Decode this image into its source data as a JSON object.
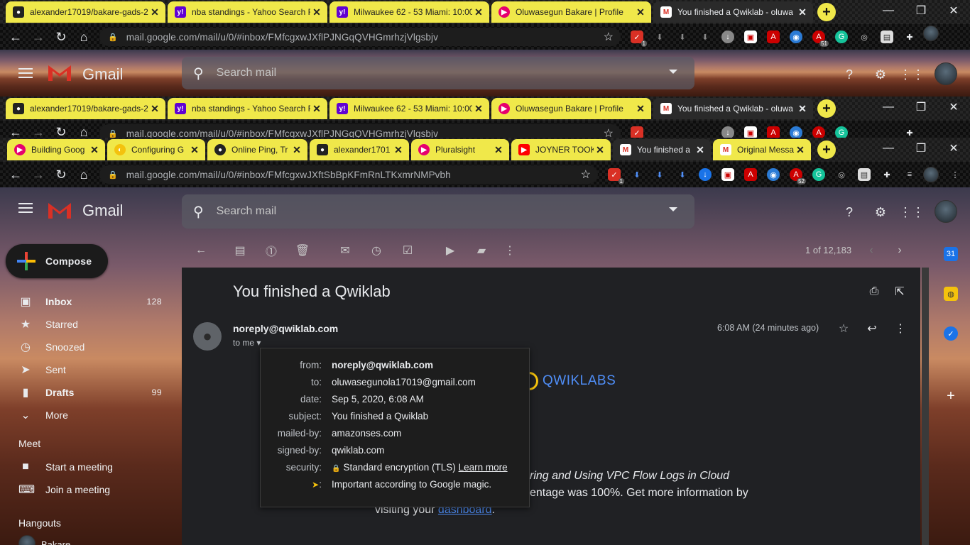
{
  "browser_top": {
    "tabs": [
      {
        "title": "alexander17019/bakare-gads-2",
        "favicon": "github-icon",
        "color": "#222"
      },
      {
        "title": "nba standings - Yahoo Search R",
        "favicon": "yahoo-icon",
        "color": "#6001d2"
      },
      {
        "title": "Milwaukee 62 - 53 Miami: 10:00",
        "favicon": "yahoo-icon",
        "color": "#6001d2"
      },
      {
        "title": "Oluwasegun Bakare | Profile",
        "favicon": "pluralsight-icon",
        "color": "#e6006e"
      },
      {
        "title": "You finished a Qwiklab - oluwa",
        "favicon": "gmail-icon",
        "color": "#d93025",
        "active": true
      }
    ],
    "url": "mail.google.com/mail/u/0/#inbox/FMfcgxwJXflPJNGqQVHGmrhzjVlgsbjv"
  },
  "browser_mid": {
    "tabs": [
      {
        "title": "alexander17019/bakare-gads-2",
        "favicon": "github-icon",
        "color": "#222"
      },
      {
        "title": "nba standings - Yahoo Search R",
        "favicon": "yahoo-icon",
        "color": "#6001d2"
      },
      {
        "title": "Milwaukee 62 - 53 Miami: 10:00",
        "favicon": "yahoo-icon",
        "color": "#6001d2"
      },
      {
        "title": "Oluwasegun Bakare | Profile",
        "favicon": "pluralsight-icon",
        "color": "#e6006e"
      },
      {
        "title": "You finished a Qwiklab - oluwa",
        "favicon": "gmail-icon",
        "color": "#d93025",
        "active": true
      }
    ],
    "url": "mail.google.com/mail/u/0/#inbox/FMfcgxwJXflPJNGqQVHGmrhzjVlgsbjv"
  },
  "browser_main": {
    "tabs": [
      {
        "title": "Building Goog",
        "favicon": "pluralsight-icon",
        "color": "#e6006e"
      },
      {
        "title": "Configuring G",
        "favicon": "qwiklabs-icon",
        "color": "#f4c20d"
      },
      {
        "title": "Online Ping, Tr",
        "favicon": "penguin-icon",
        "color": "#222"
      },
      {
        "title": "alexander1701",
        "favicon": "github-icon",
        "color": "#222"
      },
      {
        "title": "Pluralsight",
        "favicon": "pluralsight-icon",
        "color": "#e6006e"
      },
      {
        "title": "JOYNER TOOK",
        "favicon": "youtube-icon",
        "color": "#ff0000"
      },
      {
        "title": "You finished a",
        "favicon": "gmail-icon",
        "color": "#d93025",
        "active": true
      },
      {
        "title": "Original Messa",
        "favicon": "gmail-icon",
        "color": "#d93025"
      }
    ],
    "url": "mail.google.com/mail/u/0/#inbox/FMfcgxwJXftSbBpKFmRnLTKxmrNMPvbh",
    "ext_badges": [
      "1",
      "52"
    ]
  },
  "ext_badges_top": [
    "1",
    "51"
  ],
  "gmail": {
    "brand": "Gmail",
    "search_placeholder": "Search mail",
    "compose": "Compose",
    "nav": [
      {
        "label": "Inbox",
        "count": "128",
        "icon": "inbox-icon",
        "bold": true
      },
      {
        "label": "Starred",
        "count": "",
        "icon": "star-icon",
        "bold": false
      },
      {
        "label": "Snoozed",
        "count": "",
        "icon": "clock-icon",
        "bold": false
      },
      {
        "label": "Sent",
        "count": "",
        "icon": "send-icon",
        "bold": false
      },
      {
        "label": "Drafts",
        "count": "99",
        "icon": "draft-icon",
        "bold": true
      },
      {
        "label": "More",
        "count": "",
        "icon": "chevron-down-icon",
        "bold": false
      }
    ],
    "meet": {
      "heading": "Meet",
      "start": "Start a meeting",
      "join": "Join a meeting"
    },
    "hangouts": {
      "heading": "Hangouts",
      "user_partial": "Bakare"
    },
    "pager": "1 of 12,183"
  },
  "message": {
    "subject": "You finished a Qwiklab",
    "sender": "noreply@qwiklab.com",
    "to_me": "to me",
    "time": "6:08 AM (24 minutes ago)",
    "details": {
      "from_label": "from:",
      "from": "noreply@qwiklab.com",
      "to_label": "to:",
      "to": "oluwasegunola17019@gmail.com",
      "date_label": "date:",
      "date": "Sep 5, 2020, 6:08 AM",
      "subject_label": "subject:",
      "subject": "You finished a Qwiklab",
      "mailedby_label": "mailed-by:",
      "mailedby": "amazonses.com",
      "signedby_label": "signed-by:",
      "signedby": "qwiklab.com",
      "security_label": "security:",
      "security": "Standard encryption (TLS)",
      "learn_more": "Learn more",
      "importance_label": ":",
      "importance": "Important according to Google magic."
    },
    "logo_text": "QWIKLABS",
    "body_line1": "ring and Using VPC Flow Logs in Cloud",
    "body_line2": "entage was 100%. Get more information by",
    "body_line3_prefix": "visiting your ",
    "body_link": "dashboard",
    "body_line3_suffix": "."
  },
  "colors": {
    "tab_yellow": "#f0e84a",
    "link_blue": "#4f8ef7",
    "gmail_red": "#d93025",
    "qwik_yellow": "#f4c20d"
  }
}
